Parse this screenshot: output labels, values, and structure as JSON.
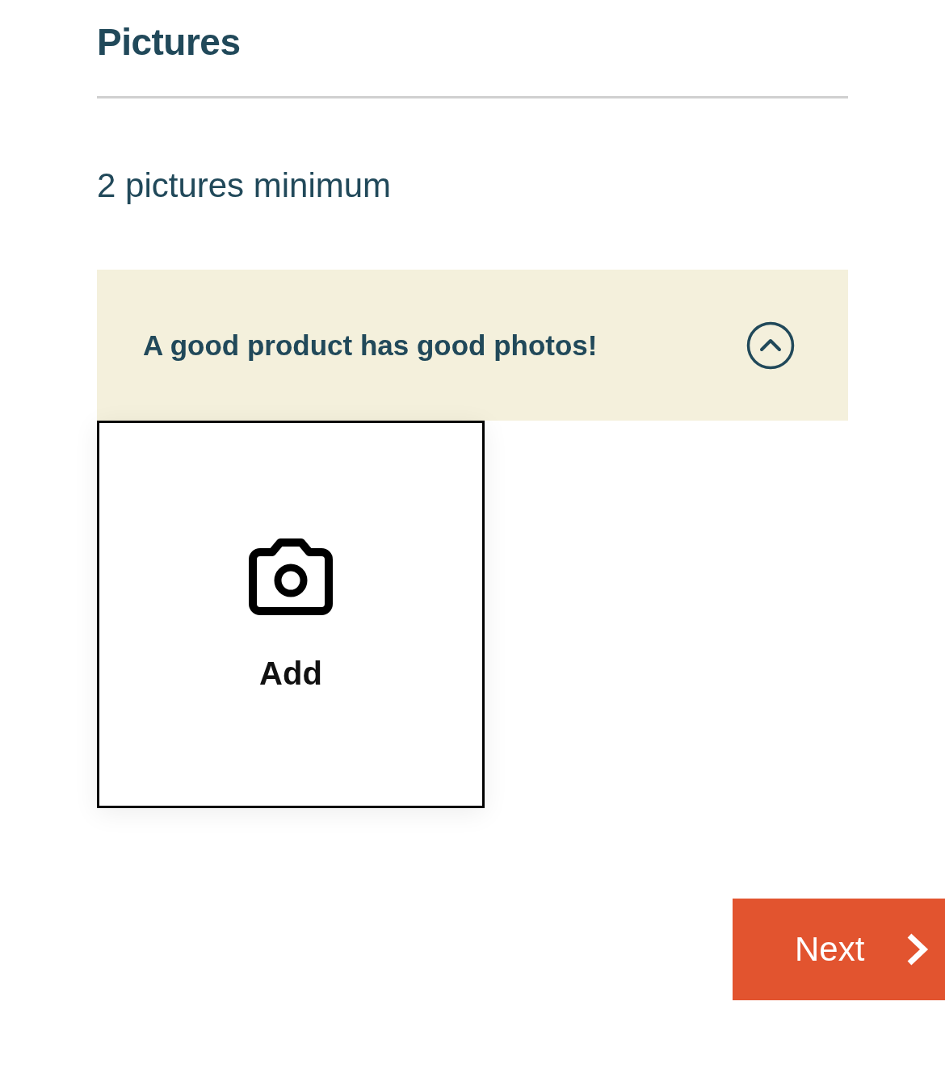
{
  "section": {
    "title": "Pictures",
    "subtitle": "2 pictures minimum"
  },
  "tip": {
    "text": "A good product has good photos!",
    "expanded": true
  },
  "upload_tile": {
    "label": "Add"
  },
  "next_button": {
    "label": "Next"
  }
}
